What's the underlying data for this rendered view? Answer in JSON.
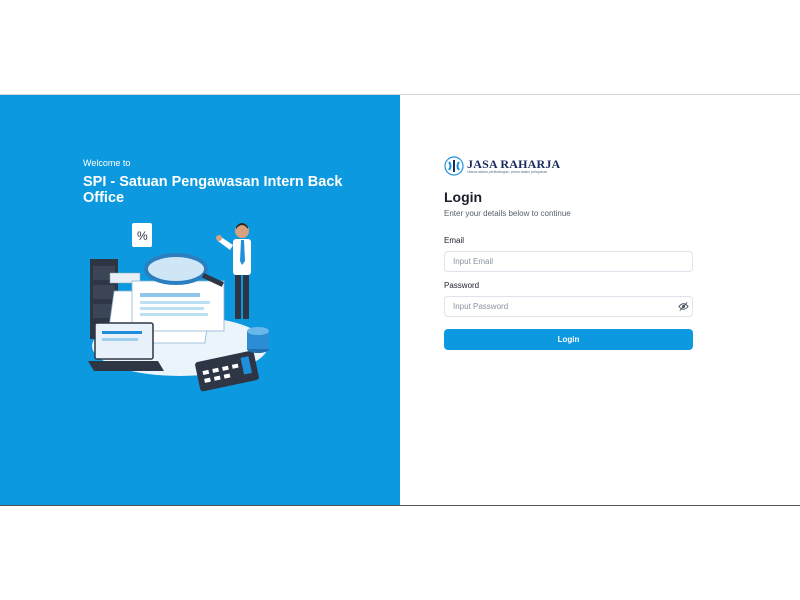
{
  "left": {
    "welcome": "Welcome to",
    "title": "SPI - Satuan Pengawasan Intern Back Office"
  },
  "logo": {
    "name": "JASA RAHARJA",
    "tagline": "Utama dalam perlindungan, prima dalam pelayanan"
  },
  "login": {
    "heading": "Login",
    "subheading": "Enter your details below to continue",
    "email_label": "Email",
    "email_placeholder": "Input Email",
    "password_label": "Password",
    "password_placeholder": "Input Password",
    "submit_label": "Login"
  },
  "colors": {
    "brand": "#0d99df",
    "text": "#1b1f2a"
  },
  "icons": {
    "password_toggle": "eye-off-icon",
    "logo": "jasa-raharja-logo-icon"
  }
}
